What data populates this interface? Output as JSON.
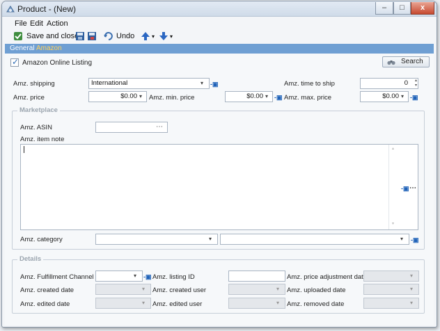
{
  "window": {
    "title": "Product - (New)",
    "controls": {
      "minimize": "–",
      "maximize": "□",
      "close": "x"
    }
  },
  "menu": {
    "file": "File",
    "edit": "Edit",
    "action": "Action"
  },
  "toolbar": {
    "save_close": "Save and close",
    "undo": "Undo"
  },
  "tabs": {
    "general": "General",
    "amazon": "Amazon"
  },
  "amazon": {
    "online_listing_label": "Amazon Online Listing",
    "online_listing_checked": true,
    "search_button": "Search",
    "shipping_label": "Amz. shipping",
    "shipping_value": "International",
    "time_to_ship_label": "Amz. time to ship",
    "time_to_ship_value": "0",
    "price_label": "Amz. price",
    "price_value": "$0.00",
    "min_price_label": "Amz. min. price",
    "min_price_value": "$0.00",
    "max_price_label": "Amz. max. price",
    "max_price_value": "$0.00"
  },
  "marketplace": {
    "group_title": "Marketplace",
    "asin_label": "Amz. ASIN",
    "asin_value": "",
    "item_note_label": "Amz. item note",
    "item_note_value": "",
    "category_label": "Amz. category",
    "category_value": "",
    "subcategory_value": ""
  },
  "details": {
    "group_title": "Details",
    "fulfillment_channel_label": "Amz. Fulfillment Channel",
    "listing_id_label": "Amz. listing ID",
    "price_adjustment_date_label": "Amz. price adjustment date",
    "created_date_label": "Amz. created date",
    "created_user_label": "Amz. created user",
    "uploaded_date_label": "Amz. uploaded date",
    "edited_date_label": "Amz. edited date",
    "edited_user_label": "Amz. edited user",
    "removed_date_label": "Amz. removed date"
  },
  "glyphs": {
    "dropdown": "▾",
    "pin": "-▣",
    "ellipsis": "⋯",
    "up": "▴",
    "down": "▾"
  },
  "colors": {
    "tab_bar": "#6f9fd3",
    "active_tab_text": "#ffd15a",
    "pin": "#1f62b8"
  }
}
